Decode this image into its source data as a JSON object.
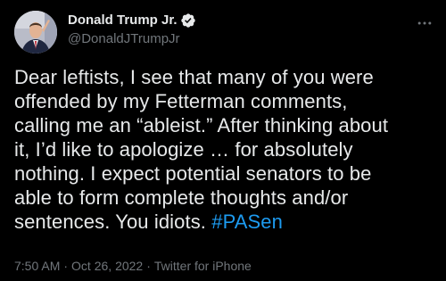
{
  "author": {
    "display_name": "Donald Trump Jr.",
    "handle": "@DonaldJTrumpJr",
    "verified": true,
    "avatar_icon": "profile-photo"
  },
  "tweet": {
    "text_lines": [
      "Dear leftists, I see that many of you were",
      "offended by my Fetterman comments,",
      "calling me an “ableist.” After thinking about",
      "it, I’d like to apologize … for absolutely",
      "nothing. I expect potential senators to be",
      "able to form complete thoughts and/or",
      "sentences. You idiots. "
    ],
    "hashtag": "#PASen"
  },
  "meta": {
    "time": "7:50 AM",
    "separator_1": "·",
    "date": "Oct 26, 2022",
    "separator_2": "·",
    "source": "Twitter for iPhone"
  },
  "icons": {
    "more": "more-options-icon",
    "verified": "verified-badge-icon"
  },
  "colors": {
    "background": "#000000",
    "text": "#e7e9ea",
    "secondary": "#71767b",
    "accent": "#1d9bf0"
  }
}
